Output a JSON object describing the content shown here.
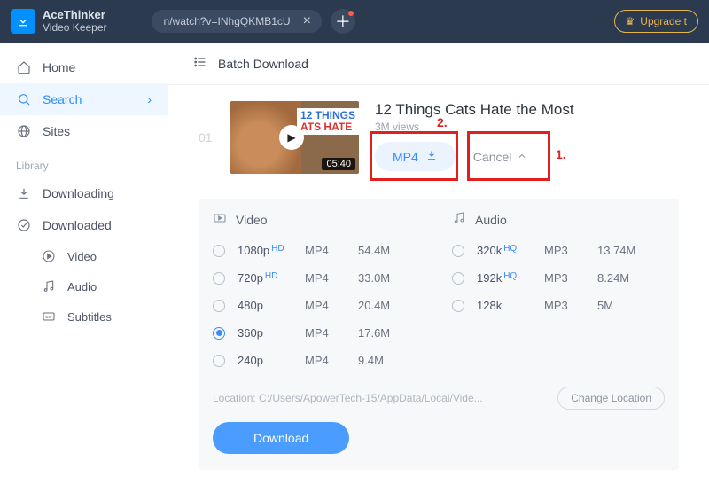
{
  "brand": {
    "name": "AceThinker",
    "product": "Video Keeper"
  },
  "header": {
    "url_text": "n/watch?v=INhgQKMB1cU",
    "upgrade_label": "Upgrade t"
  },
  "sidebar": {
    "nav": [
      {
        "icon": "home-icon",
        "label": "Home"
      },
      {
        "icon": "search-icon",
        "label": "Search",
        "active": true
      },
      {
        "icon": "sites-icon",
        "label": "Sites"
      }
    ],
    "library_heading": "Library",
    "library": [
      {
        "icon": "download-icon",
        "label": "Downloading"
      },
      {
        "icon": "downloaded-icon",
        "label": "Downloaded"
      }
    ],
    "sub": [
      {
        "icon": "play-icon",
        "label": "Video"
      },
      {
        "icon": "music-icon",
        "label": "Audio"
      },
      {
        "icon": "cc-icon",
        "label": "Subtitles"
      }
    ]
  },
  "batch_label": "Batch Download",
  "item": {
    "index": "01",
    "thumb_band_top": "12 THINGS",
    "thumb_band_bottom": "ATS HATE",
    "duration": "05:40",
    "title": "12 Things Cats Hate the Most",
    "views": "3M views",
    "mp4_label": "MP4",
    "cancel_label": "Cancel",
    "annotation_1": "1.",
    "annotation_2": "2."
  },
  "formats": {
    "video_heading": "Video",
    "audio_heading": "Audio",
    "video_rows": [
      {
        "quality": "1080p",
        "tag": "HD",
        "fmt": "MP4",
        "size": "54.4M",
        "selected": false
      },
      {
        "quality": "720p",
        "tag": "HD",
        "fmt": "MP4",
        "size": "33.0M",
        "selected": false
      },
      {
        "quality": "480p",
        "tag": "",
        "fmt": "MP4",
        "size": "20.4M",
        "selected": false
      },
      {
        "quality": "360p",
        "tag": "",
        "fmt": "MP4",
        "size": "17.6M",
        "selected": true
      },
      {
        "quality": "240p",
        "tag": "",
        "fmt": "MP4",
        "size": "9.4M",
        "selected": false
      }
    ],
    "audio_rows": [
      {
        "quality": "320k",
        "tag": "HQ",
        "fmt": "MP3",
        "size": "13.74M",
        "selected": false
      },
      {
        "quality": "192k",
        "tag": "HQ",
        "fmt": "MP3",
        "size": "8.24M",
        "selected": false
      },
      {
        "quality": "128k",
        "tag": "",
        "fmt": "MP3",
        "size": "5M",
        "selected": false
      }
    ]
  },
  "location": {
    "prefix": "Location: ",
    "path": "C:/Users/ApowerTech-15/AppData/Local/Vide...",
    "change_label": "Change Location"
  },
  "download_label": "Download"
}
